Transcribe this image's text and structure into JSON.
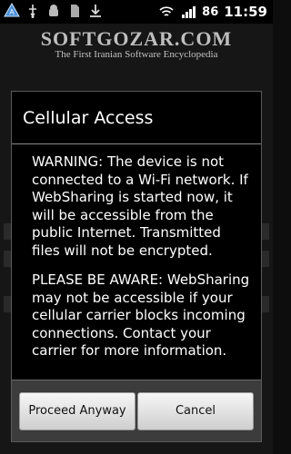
{
  "status_bar": {
    "battery": "86",
    "time": "11:59"
  },
  "watermark": {
    "title": "SOFTGOZAR.COM",
    "subtitle": "The First Iranian Software Encyclopedia"
  },
  "dialog": {
    "title": "Cellular Access",
    "warning": "WARNING: The device is not connected to a Wi-Fi network. If WebSharing is started now, it will be accessible from the public Internet. Transmitted files will not be encrypted.",
    "notice": "PLEASE BE AWARE: WebSharing may not be accessible if your cellular carrier blocks incoming connections. Contact your carrier for more information.",
    "proceed_label": "Proceed Anyway",
    "cancel_label": "Cancel"
  },
  "icons": {
    "status": [
      "app-notification-icon",
      "usb-icon",
      "android-debug-icon",
      "sd-card-icon",
      "download-icon",
      "wifi-icon",
      "signal-icon"
    ]
  }
}
